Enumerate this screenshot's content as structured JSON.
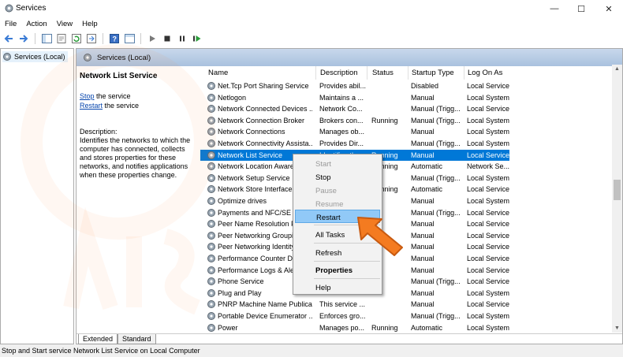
{
  "window": {
    "title": "Services"
  },
  "menu": [
    "File",
    "Action",
    "View",
    "Help"
  ],
  "tree": {
    "root_label": "Services (Local)"
  },
  "main_header": {
    "title": "Services (Local)"
  },
  "desc": {
    "service_name": "Network List Service",
    "stop_link": "Stop",
    "stop_suffix": " the service",
    "restart_link": "Restart",
    "restart_suffix": " the service",
    "description_label": "Description:",
    "description_text": "Identifies the networks to which the computer has connected, collects and stores properties for these networks, and notifies applications when these properties change."
  },
  "columns": {
    "name": "Name",
    "description": "Description",
    "status": "Status",
    "startup": "Startup Type",
    "logon": "Log On As"
  },
  "rows": [
    {
      "name": "Net.Tcp Port Sharing Service",
      "description": "Provides abil...",
      "status": "",
      "startup": "Disabled",
      "logon": "Local Service"
    },
    {
      "name": "Netlogon",
      "description": "Maintains a ...",
      "status": "",
      "startup": "Manual",
      "logon": "Local System"
    },
    {
      "name": "Network Connected Devices ...",
      "description": "Network Co...",
      "status": "",
      "startup": "Manual (Trigg...",
      "logon": "Local Service"
    },
    {
      "name": "Network Connection Broker",
      "description": "Brokers con...",
      "status": "Running",
      "startup": "Manual (Trigg...",
      "logon": "Local System"
    },
    {
      "name": "Network Connections",
      "description": "Manages ob...",
      "status": "",
      "startup": "Manual",
      "logon": "Local System"
    },
    {
      "name": "Network Connectivity Assista...",
      "description": "Provides Dir...",
      "status": "",
      "startup": "Manual (Trigg...",
      "logon": "Local System"
    },
    {
      "name": "Network List Service",
      "description": "Identifies th...",
      "status": "Running",
      "startup": "Manual",
      "logon": "Local Service",
      "selected": true
    },
    {
      "name": "Network Location Aware",
      "description": "",
      "status": "Running",
      "startup": "Automatic",
      "logon": "Network Se..."
    },
    {
      "name": "Network Setup Service",
      "description": "",
      "status": "",
      "startup": "Manual (Trigg...",
      "logon": "Local System"
    },
    {
      "name": "Network Store Interface",
      "description": "",
      "status": "Running",
      "startup": "Automatic",
      "logon": "Local Service"
    },
    {
      "name": "Optimize drives",
      "description": "",
      "status": "",
      "startup": "Manual",
      "logon": "Local System"
    },
    {
      "name": "Payments and NFC/SE M",
      "description": "",
      "status": "",
      "startup": "Manual (Trigg...",
      "logon": "Local Service"
    },
    {
      "name": "Peer Name Resolution P",
      "description": "",
      "status": "",
      "startup": "Manual",
      "logon": "Local Service"
    },
    {
      "name": "Peer Networking Groupi",
      "description": "",
      "status": "",
      "startup": "Manual",
      "logon": "Local Service"
    },
    {
      "name": "Peer Networking Identity",
      "description": "",
      "status": "",
      "startup": "Manual",
      "logon": "Local Service"
    },
    {
      "name": "Performance Counter DL",
      "description": "",
      "status": "",
      "startup": "Manual",
      "logon": "Local Service"
    },
    {
      "name": "Performance Logs & Ale",
      "description": "",
      "status": "",
      "startup": "Manual",
      "logon": "Local Service"
    },
    {
      "name": "Phone Service",
      "description": "",
      "status": "",
      "startup": "Manual (Trigg...",
      "logon": "Local Service"
    },
    {
      "name": "Plug and Play",
      "description": "",
      "status": "",
      "startup": "Manual",
      "logon": "Local System"
    },
    {
      "name": "PNRP Machine Name Publica...",
      "description": "This service ...",
      "status": "",
      "startup": "Manual",
      "logon": "Local Service"
    },
    {
      "name": "Portable Device Enumerator ...",
      "description": "Enforces gro...",
      "status": "",
      "startup": "Manual (Trigg...",
      "logon": "Local System"
    },
    {
      "name": "Power",
      "description": "Manages po...",
      "status": "Running",
      "startup": "Automatic",
      "logon": "Local System"
    }
  ],
  "context_menu": {
    "start": "Start",
    "stop": "Stop",
    "pause": "Pause",
    "resume": "Resume",
    "restart": "Restart",
    "all_tasks": "All Tasks",
    "refresh": "Refresh",
    "properties": "Properties",
    "help": "Help"
  },
  "tabs": {
    "extended": "Extended",
    "standard": "Standard"
  },
  "status_bar": "Stop and Start service Network List Service on Local Computer",
  "colors": {
    "selection": "#0078d7",
    "header_band": "#b4c9e3",
    "arrow": "#f47b20"
  }
}
